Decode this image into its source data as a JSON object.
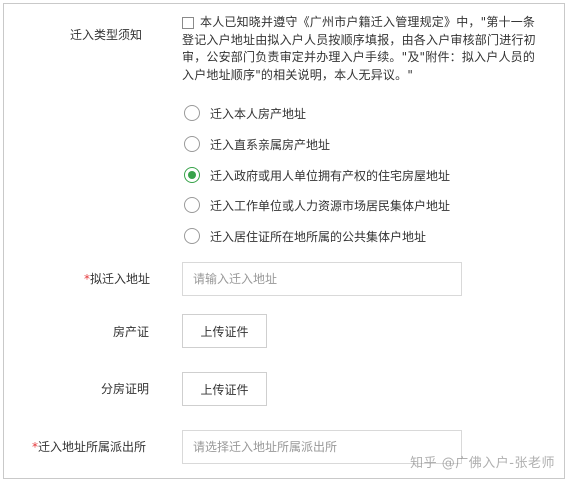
{
  "form": {
    "notice": {
      "label": "迁入类型须知",
      "text": "本人已知晓并遵守《广州市户籍迁入管理规定》中，\"第十一条 登记入户地址由拟入户人员按顺序填报，由各入户审核部门进行初审，公安部门负责审定并办理入户手续。\"及\"附件：拟入户人员的入户地址顺序\"的相关说明，本人无异议。\"",
      "checked": false
    },
    "options": [
      {
        "label": "迁入本人房产地址",
        "checked": false
      },
      {
        "label": "迁入直系亲属房产地址",
        "checked": false
      },
      {
        "label": "迁入政府或用人单位拥有产权的住宅房屋地址",
        "checked": true
      },
      {
        "label": "迁入工作单位或人力资源市场居民集体户地址",
        "checked": false
      },
      {
        "label": "迁入居住证所在地所属的公共集体户地址",
        "checked": false
      }
    ],
    "address": {
      "required_mark": "*",
      "label": "拟迁入地址",
      "placeholder": "请输入迁入地址",
      "value": ""
    },
    "property_cert": {
      "label": "房产证",
      "button": "上传证件"
    },
    "housing_proof": {
      "label": "分房证明",
      "button": "上传证件"
    },
    "police_station": {
      "required_mark": "*",
      "label": "迁入地址所属派出所",
      "placeholder": "请选择迁入地址所属派出所",
      "value": ""
    }
  },
  "watermark": "知乎 @广佛入户-张老师",
  "colors": {
    "accent": "#37a34a",
    "required": "#e4393c",
    "border": "#d9d9d9"
  }
}
